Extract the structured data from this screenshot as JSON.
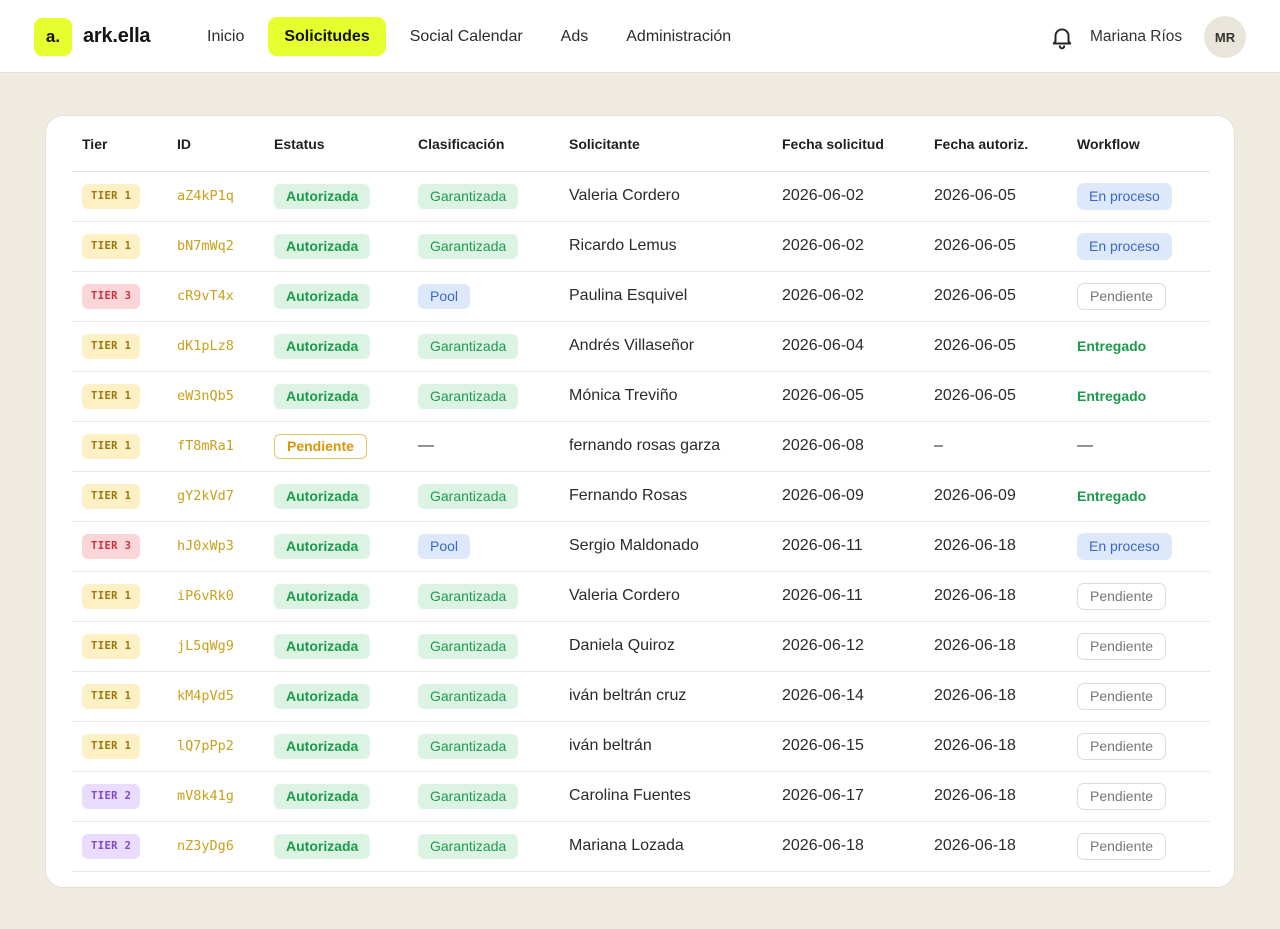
{
  "brand": {
    "mark": "a.",
    "name": "ark.ella"
  },
  "nav": [
    {
      "label": "Inicio",
      "active": false
    },
    {
      "label": "Solicitudes",
      "active": true
    },
    {
      "label": "Social Calendar",
      "active": false
    },
    {
      "label": "Ads",
      "active": false
    },
    {
      "label": "Administración",
      "active": false
    }
  ],
  "user": {
    "name": "Mariana Ríos",
    "initials": "MR"
  },
  "table": {
    "headers": [
      "Tier",
      "ID",
      "Estatus",
      "Clasificación",
      "Solicitante",
      "Fecha solicitud",
      "Fecha autoriz.",
      "Workflow"
    ],
    "rows": [
      {
        "tier": "TIER 1",
        "tier_level": 1,
        "id": "aZ4kP1q",
        "status": "Autorizada",
        "class": "Garantizada",
        "applicant": "Valeria Cordero",
        "req_date": "2026-06-02",
        "auth_date": "2026-06-05",
        "workflow": "En proceso"
      },
      {
        "tier": "TIER 1",
        "tier_level": 1,
        "id": "bN7mWq2",
        "status": "Autorizada",
        "class": "Garantizada",
        "applicant": "Ricardo Lemus",
        "req_date": "2026-06-02",
        "auth_date": "2026-06-05",
        "workflow": "En proceso"
      },
      {
        "tier": "TIER 3",
        "tier_level": 3,
        "id": "cR9vT4x",
        "status": "Autorizada",
        "class": "Pool",
        "applicant": "Paulina Esquivel",
        "req_date": "2026-06-02",
        "auth_date": "2026-06-05",
        "workflow": "Pendiente"
      },
      {
        "tier": "TIER 1",
        "tier_level": 1,
        "id": "dK1pLz8",
        "status": "Autorizada",
        "class": "Garantizada",
        "applicant": "Andrés Villaseñor",
        "req_date": "2026-06-04",
        "auth_date": "2026-06-05",
        "workflow": "Entregado"
      },
      {
        "tier": "TIER 1",
        "tier_level": 1,
        "id": "eW3nQb5",
        "status": "Autorizada",
        "class": "Garantizada",
        "applicant": "Mónica Treviño",
        "req_date": "2026-06-05",
        "auth_date": "2026-06-05",
        "workflow": "Entregado"
      },
      {
        "tier": "TIER 1",
        "tier_level": 1,
        "id": "fT8mRa1",
        "status": "Pendiente",
        "class": "—",
        "applicant": "fernando rosas garza",
        "req_date": "2026-06-08",
        "auth_date": "–",
        "workflow": "—"
      },
      {
        "tier": "TIER 1",
        "tier_level": 1,
        "id": "gY2kVd7",
        "status": "Autorizada",
        "class": "Garantizada",
        "applicant": "Fernando Rosas",
        "req_date": "2026-06-09",
        "auth_date": "2026-06-09",
        "workflow": "Entregado"
      },
      {
        "tier": "TIER 3",
        "tier_level": 3,
        "id": "hJ0xWp3",
        "status": "Autorizada",
        "class": "Pool",
        "applicant": "Sergio Maldonado",
        "req_date": "2026-06-11",
        "auth_date": "2026-06-18",
        "workflow": "En proceso"
      },
      {
        "tier": "TIER 1",
        "tier_level": 1,
        "id": "iP6vRk0",
        "status": "Autorizada",
        "class": "Garantizada",
        "applicant": "Valeria Cordero",
        "req_date": "2026-06-11",
        "auth_date": "2026-06-18",
        "workflow": "Pendiente"
      },
      {
        "tier": "TIER 1",
        "tier_level": 1,
        "id": "jL5qWg9",
        "status": "Autorizada",
        "class": "Garantizada",
        "applicant": "Daniela Quiroz",
        "req_date": "2026-06-12",
        "auth_date": "2026-06-18",
        "workflow": "Pendiente"
      },
      {
        "tier": "TIER 1",
        "tier_level": 1,
        "id": "kM4pVd5",
        "status": "Autorizada",
        "class": "Garantizada",
        "applicant": "iván beltrán cruz",
        "req_date": "2026-06-14",
        "auth_date": "2026-06-18",
        "workflow": "Pendiente"
      },
      {
        "tier": "TIER 1",
        "tier_level": 1,
        "id": "lQ7pPp2",
        "status": "Autorizada",
        "class": "Garantizada",
        "applicant": "iván beltrán",
        "req_date": "2026-06-15",
        "auth_date": "2026-06-18",
        "workflow": "Pendiente"
      },
      {
        "tier": "TIER 2",
        "tier_level": 2,
        "id": "mV8k41g",
        "status": "Autorizada",
        "class": "Garantizada",
        "applicant": "Carolina Fuentes",
        "req_date": "2026-06-17",
        "auth_date": "2026-06-18",
        "workflow": "Pendiente"
      },
      {
        "tier": "TIER 2",
        "tier_level": 2,
        "id": "nZ3yDg6",
        "status": "Autorizada",
        "class": "Garantizada",
        "applicant": "Mariana Lozada",
        "req_date": "2026-06-18",
        "auth_date": "2026-06-18",
        "workflow": "Pendiente"
      }
    ]
  },
  "colors": {
    "accent": "#e6ff2f",
    "page_bg": "#efebe1",
    "tier1": "#fdf0c4",
    "tier2": "#eadcff",
    "tier3": "#fbd6d9",
    "success": "#1a9b4b",
    "info": "#3b68c8",
    "warning": "#d9950c"
  },
  "icons": {
    "notifications": "bell-icon"
  }
}
